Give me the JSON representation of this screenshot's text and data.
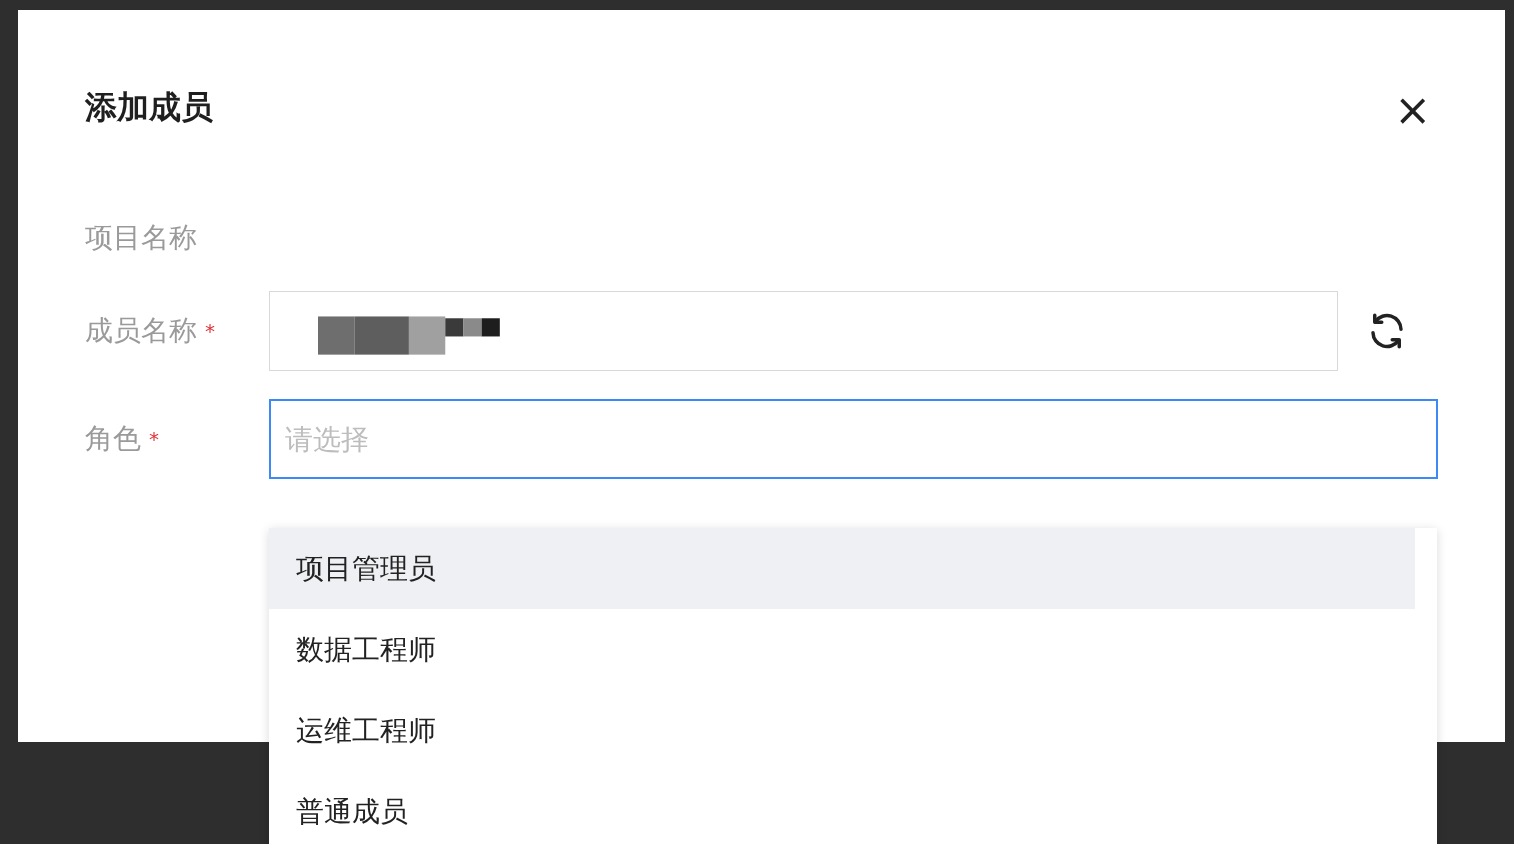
{
  "dialog": {
    "title": "添加成员",
    "close": "×"
  },
  "required_mark": "*",
  "fields": [
    {
      "kind": "text",
      "label": "项目名称",
      "required": false
    },
    {
      "kind": "input",
      "label": "成员名称",
      "required": true
    },
    {
      "kind": "select",
      "label": "角色",
      "required": true,
      "placeholder": "请选择",
      "focused": true
    }
  ],
  "dropdown": {
    "options": [
      {
        "label": "项目管理员",
        "selected": true
      },
      {
        "label": "数据工程师",
        "selected": false
      },
      {
        "label": "运维工程师",
        "selected": false
      },
      {
        "label": "普通成员",
        "selected": false
      }
    ]
  }
}
